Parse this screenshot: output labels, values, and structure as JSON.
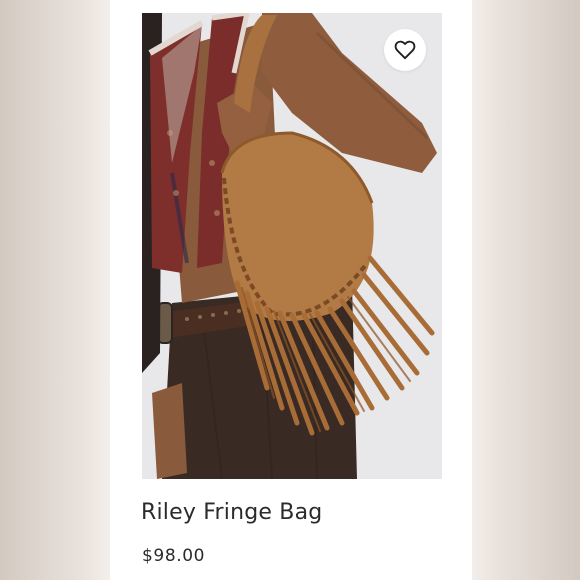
{
  "product": {
    "title": "Riley Fringe Bag",
    "price": "$98.00"
  },
  "icons": {
    "favorite": "heart-outline-icon"
  },
  "colors": {
    "suede": "#b27a45",
    "fringe": "#a86c37",
    "skirt": "#3a2a24",
    "vest": "#7e2f2c",
    "text": "#2b2b2b"
  }
}
